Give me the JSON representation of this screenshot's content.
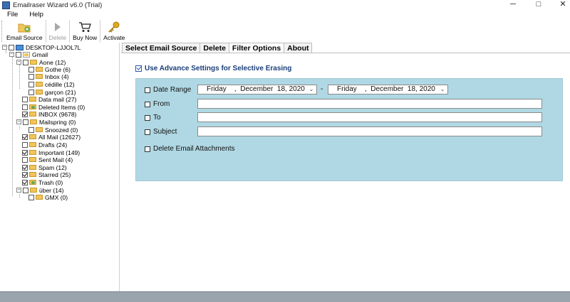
{
  "window": {
    "title": "Emailraser Wizard v6.0 (Trial)",
    "minimize": "─",
    "maximize": "□",
    "close": "✕"
  },
  "menu": [
    "File",
    "Help"
  ],
  "toolbar": {
    "email_source": "Email Source",
    "delete": "Delete",
    "buy_now": "Buy Now",
    "activate": "Activate"
  },
  "tree": {
    "root": "DESKTOP-LJJOL7L",
    "account": "Gmail",
    "nodes": [
      {
        "label": "Aone (12)",
        "checked": false
      },
      {
        "label": "Gothe (6)",
        "checked": false
      },
      {
        "label": "Inbox (4)",
        "checked": false
      },
      {
        "label": "cédille (12)",
        "checked": false
      },
      {
        "label": "garçon (21)",
        "checked": false
      },
      {
        "label": "Data mail (27)",
        "checked": false
      },
      {
        "label": "Deleted Items (0)",
        "checked": false
      },
      {
        "label": "INBOX (9678)",
        "checked": true
      },
      {
        "label": "Mailspring (0)",
        "checked": false
      },
      {
        "label": "Snoozed (0)",
        "checked": false
      },
      {
        "label": "All Mail (12627)",
        "checked": true
      },
      {
        "label": "Drafts (24)",
        "checked": false
      },
      {
        "label": "Important (149)",
        "checked": true
      },
      {
        "label": "Sent Mail (4)",
        "checked": false
      },
      {
        "label": "Spam (12)",
        "checked": true
      },
      {
        "label": "Starred (25)",
        "checked": true
      },
      {
        "label": "Trash (0)",
        "checked": true
      },
      {
        "label": "über (14)",
        "checked": false
      },
      {
        "label": "GMX (0)",
        "checked": false
      }
    ]
  },
  "tabs": [
    "Select Email Source",
    "Delete",
    "Filter Options",
    "About"
  ],
  "active_tab": "Filter Options",
  "filter": {
    "advance_label": "Use Advance Settings for Selective Erasing",
    "advance_checked": true,
    "date_range_label": "Date Range",
    "date_from": "Friday    ,  December  18, 2020",
    "date_to": "Friday    ,  December  18, 2020",
    "dash": "-",
    "from_label": "From",
    "from_value": "",
    "to_label": "To",
    "to_value": "",
    "subject_label": "Subject",
    "subject_value": "",
    "attachments_label": "Delete Email Attachments",
    "panel_color": "#b0d8e4",
    "dropdown_glyph": "⌄"
  }
}
